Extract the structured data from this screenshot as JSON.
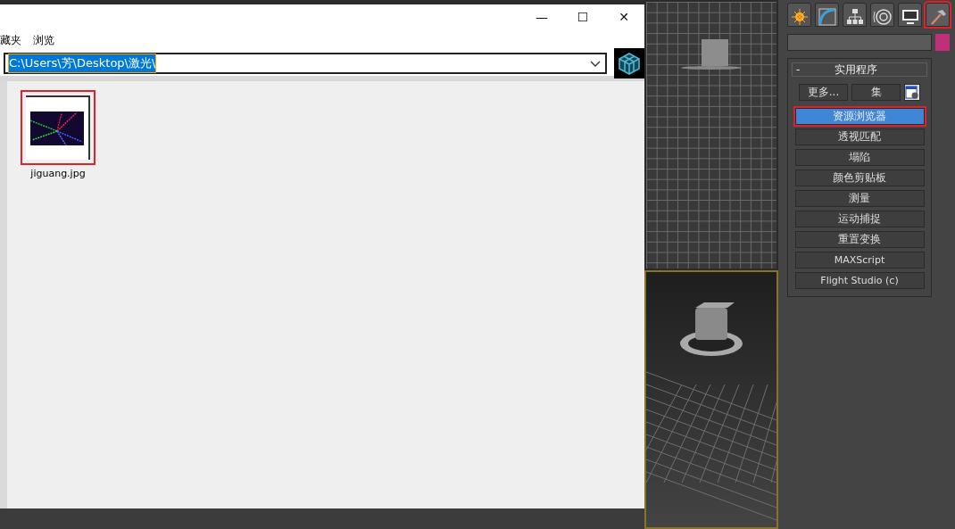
{
  "browser": {
    "window_controls": [
      "—",
      "☐",
      "✕"
    ],
    "menu": [
      "藏夹",
      "浏览"
    ],
    "address": {
      "value": "C:\\Users\\芳\\Desktop\\激光\\",
      "selected": true
    },
    "files": [
      {
        "name": "jiguang.jpg",
        "selected": true
      }
    ]
  },
  "command_panel": {
    "tabs": [
      {
        "kind": "create",
        "selected": false
      },
      {
        "kind": "modify",
        "selected": false
      },
      {
        "kind": "hierarchy",
        "selected": false
      },
      {
        "kind": "motion",
        "selected": false
      },
      {
        "kind": "display",
        "selected": false
      },
      {
        "kind": "utilities",
        "selected": true
      }
    ],
    "rollout": {
      "toggle": "-",
      "title": "实用程序",
      "top_buttons": [
        "更多...",
        "集"
      ],
      "utilities": [
        {
          "label": "资源浏览器",
          "selected": true
        },
        {
          "label": "透视匹配",
          "selected": false
        },
        {
          "label": "塌陷",
          "selected": false
        },
        {
          "label": "颜色剪贴板",
          "selected": false
        },
        {
          "label": "测量",
          "selected": false
        },
        {
          "label": "运动捕捉",
          "selected": false
        },
        {
          "label": "重置变换",
          "selected": false
        },
        {
          "label": "MAXScript",
          "selected": false
        },
        {
          "label": "Flight Studio (c)",
          "selected": false
        }
      ]
    }
  }
}
